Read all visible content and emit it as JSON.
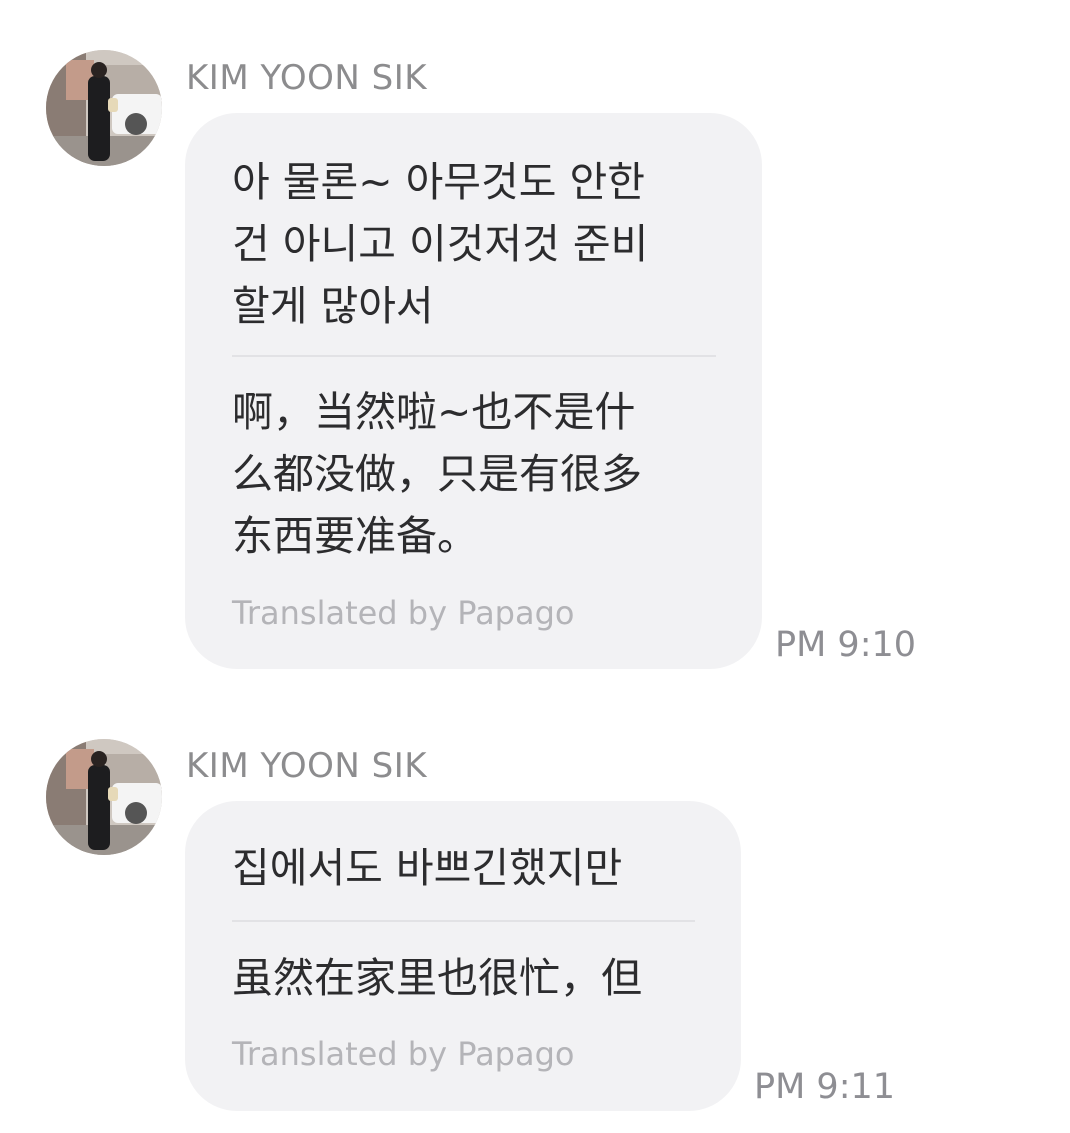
{
  "messages": [
    {
      "sender": "KIM YOON SIK",
      "original": "아 물론~ 아무것도 안한\n건 아니고 이것저것 준비\n할게 많아서",
      "translation": "啊，当然啦~也不是什\n么都没做，只是有很多\n东西要准备。",
      "credit": "Translated by Papago",
      "time": "PM 9:10"
    },
    {
      "sender": "KIM YOON SIK",
      "original": "집에서도 바쁘긴했지만",
      "translation": "虽然在家里也很忙，但",
      "credit": "Translated by Papago",
      "time": "PM 9:11"
    }
  ],
  "colors": {
    "bubble": "#f2f2f4",
    "sender": "#8c8c8e",
    "time": "#8e8e93",
    "credit": "#b4b4b8"
  }
}
